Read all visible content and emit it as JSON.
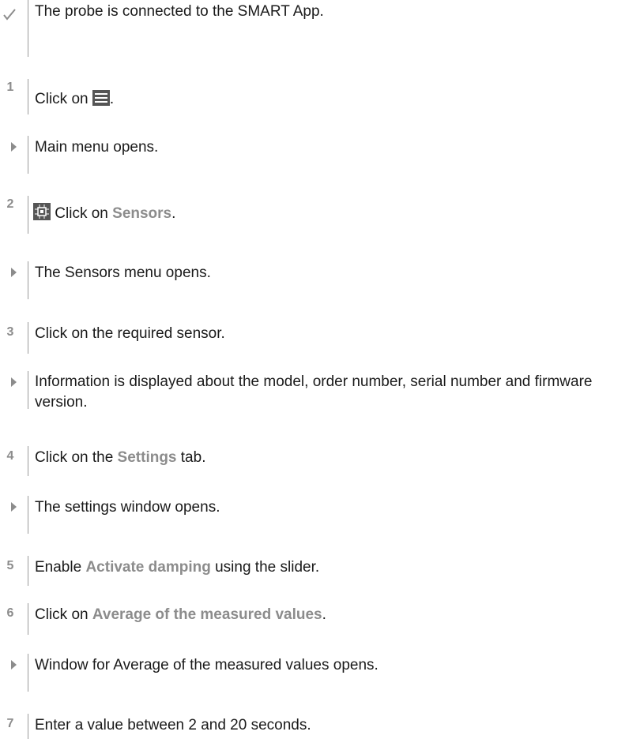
{
  "steps": [
    {
      "marker": "check",
      "label": "",
      "text": "The probe is connected to the SMART App."
    },
    {
      "marker": "number",
      "label": "1",
      "text_before": "Click on ",
      "icon": "menu-icon",
      "text_after": "."
    },
    {
      "marker": "result",
      "label": "",
      "text": "Main menu opens."
    },
    {
      "marker": "number",
      "label": "2",
      "icon": "sensor-chip-icon",
      "text_before": " Click on ",
      "highlight": "Sensors",
      "text_after": "."
    },
    {
      "marker": "result",
      "label": "",
      "text": "The Sensors menu opens."
    },
    {
      "marker": "number",
      "label": "3",
      "text": "Click on the required sensor."
    },
    {
      "marker": "result",
      "label": "",
      "text": "Information is displayed about the model, order number, serial number and firmware version."
    },
    {
      "marker": "number",
      "label": "4",
      "text_before": "Click on the ",
      "highlight": "Settings",
      "text_after": " tab."
    },
    {
      "marker": "result",
      "label": "",
      "text": "The settings window opens."
    },
    {
      "marker": "number",
      "label": "5",
      "text_before": "Enable ",
      "highlight": "Activate damping",
      "text_after": " using the slider."
    },
    {
      "marker": "number",
      "label": "6",
      "text_before": "Click on ",
      "highlight": "Average of the measured values",
      "text_after": "."
    },
    {
      "marker": "result",
      "label": "",
      "text": "Window for Average of the measured values opens."
    },
    {
      "marker": "number",
      "label": "7",
      "text": "Enter a value between 2 and 20 seconds."
    }
  ],
  "colors": {
    "accent": "#8c8c8c",
    "text": "#1a1a1a",
    "line": "#9a9a9a"
  }
}
